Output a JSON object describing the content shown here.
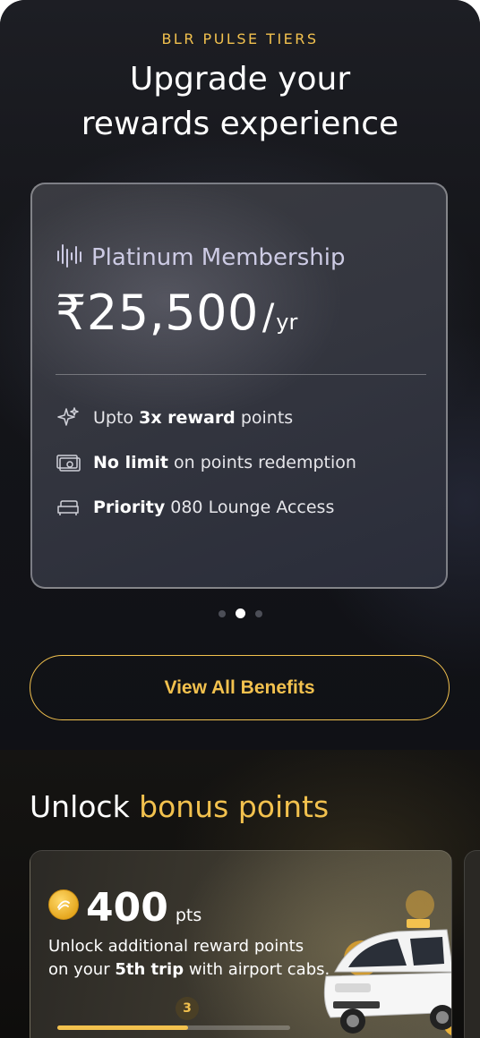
{
  "hero": {
    "eyebrow": "BLR PULSE TIERS",
    "headline_line1": "Upgrade your",
    "headline_line2": "rewards experience"
  },
  "tier_card": {
    "name": "Platinum Membership",
    "price": "₹25,500",
    "per_slash": "/",
    "per_unit": "yr",
    "benefits": [
      {
        "icon": "sparkles-icon",
        "prefix": "Upto ",
        "bold": "3x reward",
        "suffix": " points"
      },
      {
        "icon": "cash-icon",
        "prefix": "",
        "bold": "No limit",
        "suffix": " on points redemption"
      },
      {
        "icon": "sofa-icon",
        "prefix": "",
        "bold": "Priority",
        "suffix": " 080 Lounge Access"
      }
    ]
  },
  "carousel": {
    "count": 3,
    "active_index": 1
  },
  "cta": {
    "label": "View All Benefits"
  },
  "bonus": {
    "title_plain": "Unlock ",
    "title_highlight": "bonus points",
    "offer": {
      "points": "400",
      "unit": "pts",
      "desc_line1": "Unlock additional reward points",
      "desc_prefix": "on your ",
      "desc_bold": "5th trip",
      "desc_suffix": " with airport cabs.",
      "step_badge": "3",
      "progress_fraction": 0.56
    }
  },
  "colors": {
    "accent": "#f2c14e",
    "background": "#0c0c0f"
  }
}
